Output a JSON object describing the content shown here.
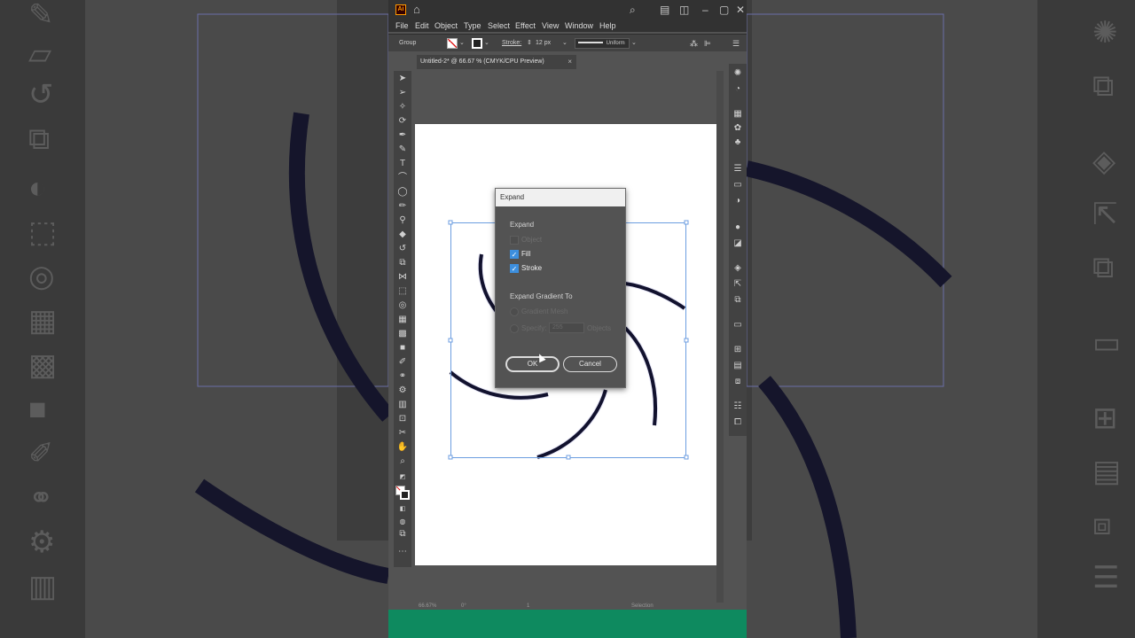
{
  "app": {
    "name": "Adobe Illustrator",
    "logo_text": "Ai",
    "accent": "#ff9a00"
  },
  "menu": [
    "File",
    "Edit",
    "Object",
    "Type",
    "Select",
    "Effect",
    "View",
    "Window",
    "Help"
  ],
  "control_bar": {
    "selection_label": "Group",
    "stroke_label": "Stroke:",
    "stroke_weight": "12 px",
    "profile": "Uniform"
  },
  "document_tab": {
    "title": "Untitled-2* @ 66.67 % (CMYK/CPU Preview)",
    "close": "×"
  },
  "dialog": {
    "title": "Expand",
    "expand_group": "Expand",
    "options": [
      {
        "label": "Object",
        "checked": false,
        "disabled": true
      },
      {
        "label": "Fill",
        "checked": true,
        "disabled": false
      },
      {
        "label": "Stroke",
        "checked": true,
        "disabled": false
      }
    ],
    "gradient_group": "Expand Gradient To",
    "gradient_mesh_label": "Gradient Mesh",
    "specify_label": "Specify:",
    "specify_value": "255",
    "objects_label": "Objects",
    "ok_label": "OK",
    "cancel_label": "Cancel"
  },
  "status": {
    "zoom": "66.67%",
    "rotation": "0°",
    "artboard": "1",
    "tool": "Selection"
  },
  "colors": {
    "stroke_color": "#12122e",
    "highlight": "#3d8fde",
    "bottom_bar": "#0e8a5f"
  }
}
